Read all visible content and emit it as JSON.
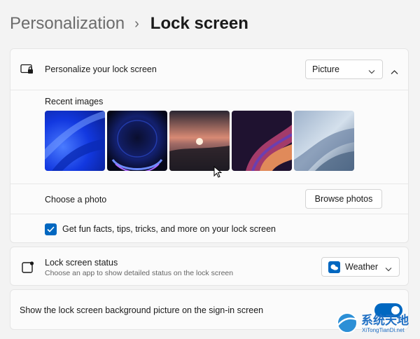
{
  "breadcrumb": {
    "parent": "Personalization",
    "separator": "›",
    "current": "Lock screen"
  },
  "personalize": {
    "label": "Personalize your lock screen",
    "dropdown_value": "Picture",
    "icon": "lock-screen-monitor-icon",
    "expanded": true
  },
  "recent_images": {
    "label": "Recent images",
    "images": [
      {
        "name": "blue-bloom",
        "colors": [
          "#0b2fd6",
          "#3b6cff",
          "#0a1f8f"
        ]
      },
      {
        "name": "dark-glow",
        "colors": [
          "#0a1242",
          "#2a3fd0",
          "#8a4dff"
        ]
      },
      {
        "name": "sunset-lake",
        "colors": [
          "#3a2a36",
          "#f0a48a",
          "#1e1b23"
        ]
      },
      {
        "name": "purple-swirl",
        "colors": [
          "#2a1640",
          "#b0456a",
          "#e08a5a"
        ]
      },
      {
        "name": "grey-flow",
        "colors": [
          "#7f95b0",
          "#c8d6e6",
          "#4e6684"
        ]
      }
    ]
  },
  "choose_photo": {
    "label": "Choose a photo",
    "button_label": "Browse photos"
  },
  "fun_facts": {
    "label": "Get fun facts, tips, tricks, and more on your lock screen",
    "checked": true
  },
  "status": {
    "title": "Lock screen status",
    "subtitle": "Choose an app to show detailed status on the lock screen",
    "dropdown_value": "Weather",
    "icon": "lock-screen-status-icon"
  },
  "signin_picture": {
    "label": "Show the lock screen background picture on the sign-in screen",
    "toggle_on": true
  },
  "watermark": {
    "text": "系统天地",
    "url_text": "XiTongTianDi.net"
  },
  "colors": {
    "accent": "#0067c0",
    "background": "#f3f3f3",
    "card": "#fbfbfb"
  }
}
